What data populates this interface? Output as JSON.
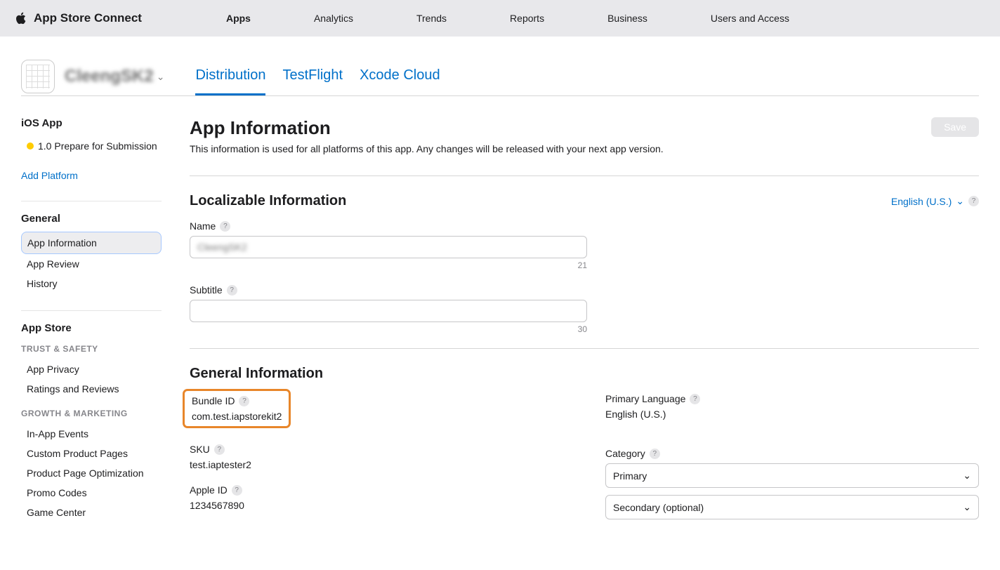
{
  "topbar": {
    "brand": "App Store Connect",
    "nav": [
      "Apps",
      "Analytics",
      "Trends",
      "Reports",
      "Business",
      "Users and Access"
    ]
  },
  "appHeader": {
    "appName": "CleengSK2",
    "tabs": [
      "Distribution",
      "TestFlight",
      "Xcode Cloud"
    ]
  },
  "sidebar": {
    "iosApp": {
      "title": "iOS App",
      "status": "1.0 Prepare for Submission"
    },
    "addPlatform": "Add Platform",
    "general": {
      "title": "General",
      "items": [
        "App Information",
        "App Review",
        "History"
      ]
    },
    "appStore": {
      "title": "App Store",
      "trustSafety": {
        "label": "TRUST & SAFETY",
        "items": [
          "App Privacy",
          "Ratings and Reviews"
        ]
      },
      "growth": {
        "label": "GROWTH & MARKETING",
        "items": [
          "In-App Events",
          "Custom Product Pages",
          "Product Page Optimization",
          "Promo Codes",
          "Game Center"
        ]
      }
    }
  },
  "main": {
    "title": "App Information",
    "desc": "This information is used for all platforms of this app. Any changes will be released with your next app version.",
    "saveLabel": "Save",
    "localizable": {
      "title": "Localizable Information",
      "language": "English (U.S.)",
      "name": {
        "label": "Name",
        "value": "CleengSK2",
        "count": "21"
      },
      "subtitle": {
        "label": "Subtitle",
        "value": "",
        "count": "30"
      }
    },
    "generalInfo": {
      "title": "General Information",
      "bundleId": {
        "label": "Bundle ID",
        "value": "com.test.iapstorekit2"
      },
      "sku": {
        "label": "SKU",
        "value": "test.iaptester2"
      },
      "appleId": {
        "label": "Apple ID",
        "value": "1234567890"
      },
      "primaryLang": {
        "label": "Primary Language",
        "value": "English (U.S.)"
      },
      "category": {
        "label": "Category",
        "primary": "Primary",
        "secondary": "Secondary (optional)"
      }
    }
  }
}
